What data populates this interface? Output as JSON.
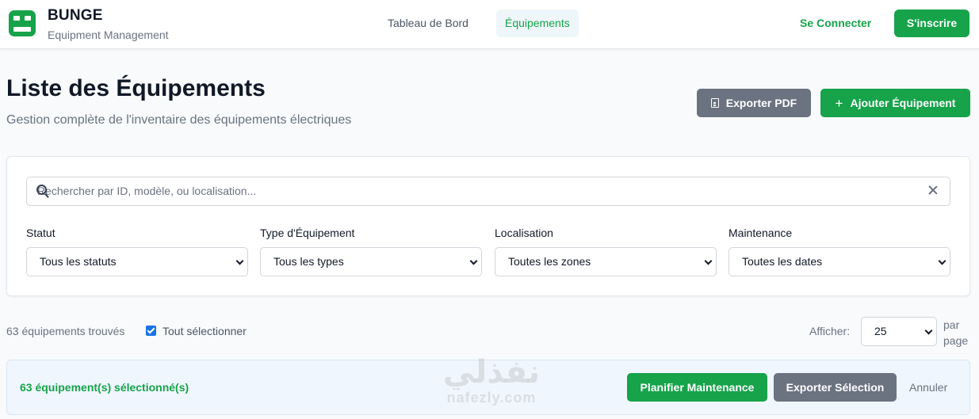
{
  "header": {
    "brand_name": "BUNGE",
    "brand_subtitle": "Equipment Management",
    "nav": [
      {
        "label": "Tableau de Bord",
        "active": false
      },
      {
        "label": "Équipements",
        "active": true
      }
    ],
    "login_label": "Se Connecter",
    "signup_label": "S'inscrire",
    "logo_icon": "robot-icon",
    "accent_color": "#16a34a"
  },
  "page": {
    "title": "Liste des Équipements",
    "subtitle": "Gestion complète de l'inventaire des équipements électriques",
    "export_pdf_label": "Exporter PDF",
    "add_label": "Ajouter Équipement"
  },
  "filters": {
    "search_placeholder": "Rechercher par ID, modèle, ou localisation...",
    "search_value": "",
    "status": {
      "label": "Statut",
      "value": "Tous les statuts"
    },
    "type": {
      "label": "Type d'Équipement",
      "value": "Tous les types"
    },
    "location": {
      "label": "Localisation",
      "value": "Toutes les zones"
    },
    "maintenance": {
      "label": "Maintenance",
      "value": "Toutes les dates"
    }
  },
  "results": {
    "count_text": "63 équipements trouvés",
    "select_all_label": "Tout sélectionner",
    "select_all_checked": true,
    "show_label": "Afficher:",
    "per_page_value": "25",
    "per_page_suffix": "par page"
  },
  "selection_bar": {
    "selected_text": "63 équipement(s) sélectionné(s)",
    "plan_label": "Planifier Maintenance",
    "export_selection_label": "Exporter Sélection",
    "cancel_label": "Annuler"
  },
  "watermark": {
    "arabic": "نفذلي",
    "latin": "nafezly.com"
  }
}
